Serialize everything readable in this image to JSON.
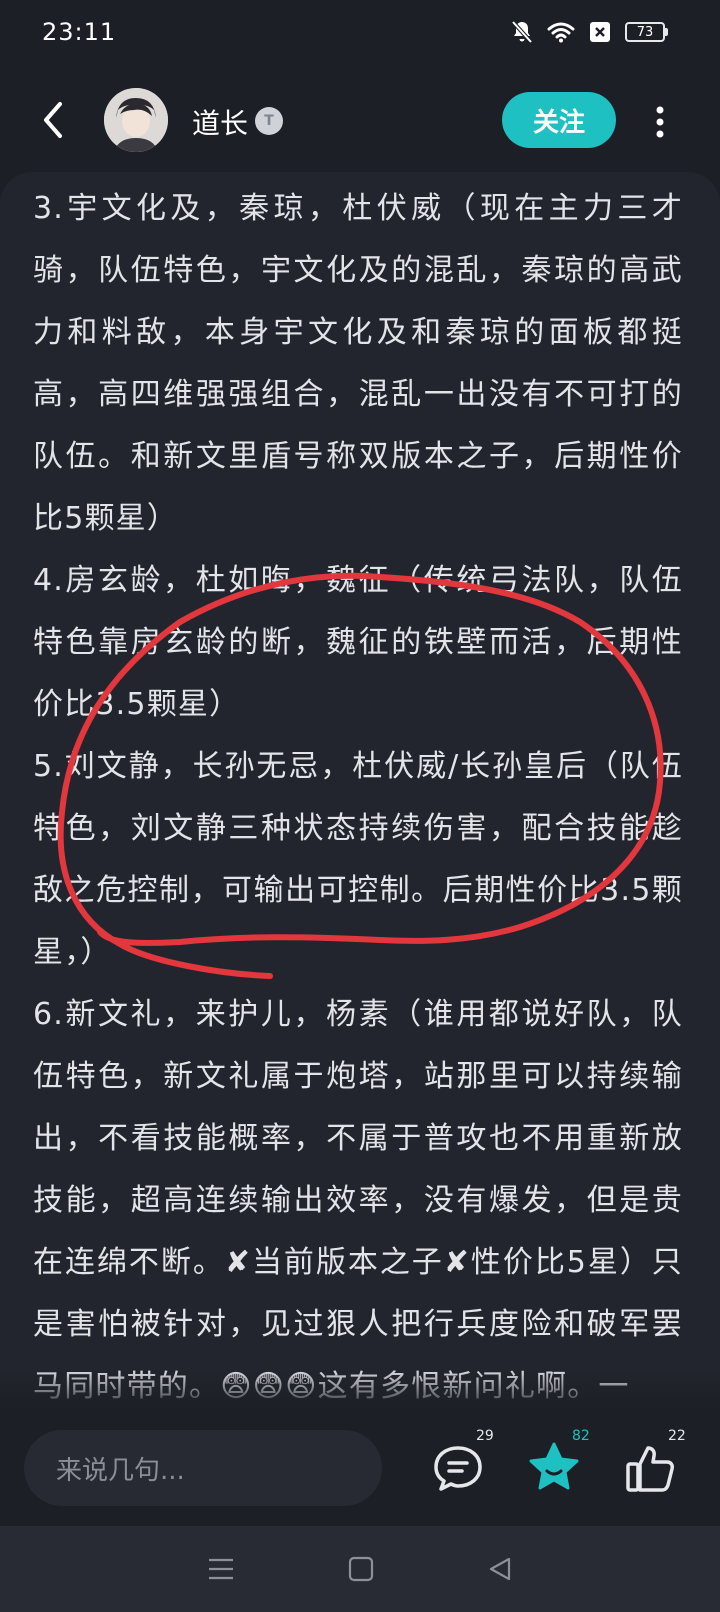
{
  "status_bar": {
    "time": "23:11",
    "battery": "73"
  },
  "header": {
    "author_name": "道长",
    "level_badge": "T",
    "follow_label": "关注"
  },
  "article": {
    "paragraphs": [
      "3.宇文化及，秦琼，杜伏威（现在主力三才骑，队伍特色，宇文化及的混乱，秦琼的高武力和料敌，本身宇文化及和秦琼的面板都挺高，高四维强强组合，混乱一出没有不可打的队伍。和新文里盾号称双版本之子，后期性价比5颗星）",
      "4.房玄龄，杜如晦，魏征（传统弓法队，队伍特色靠房玄龄的断，魏征的铁壁而活，后期性价比3.5颗星）",
      "5.刘文静，长孙无忌，杜伏威/长孙皇后（队伍特色，刘文静三种状态持续伤害，配合技能趁敌之危控制，可输出可控制。后期性价比3.5颗星，）",
      "6.新文礼，来护儿，杨素（谁用都说好队，队伍特色，新文礼属于炮塔，站那里可以持续输出，不看技能概率，不属于普攻也不用重新放技能，超高连续输出效率，没有爆发，但是贵在连绵不断。✘当前版本之子✘性价比5星）只是害怕被针对，见过狠人把行兵度险和破军罢马同时带的。😨😨😨这有多恨新问礼啊。一"
    ]
  },
  "comment_bar": {
    "placeholder": "来说几句...",
    "comment_count": "29",
    "favorite_count": "82",
    "like_count": "22"
  },
  "colors": {
    "accent": "#1ec0c2",
    "background": "#1d1f26",
    "card": "#23252e",
    "annotation": "#e2373d"
  },
  "icons": {
    "back": "chevron-left-icon",
    "more": "more-vertical-icon",
    "comment": "comment-icon",
    "favorite": "star-icon",
    "like": "thumbs-up-icon"
  }
}
